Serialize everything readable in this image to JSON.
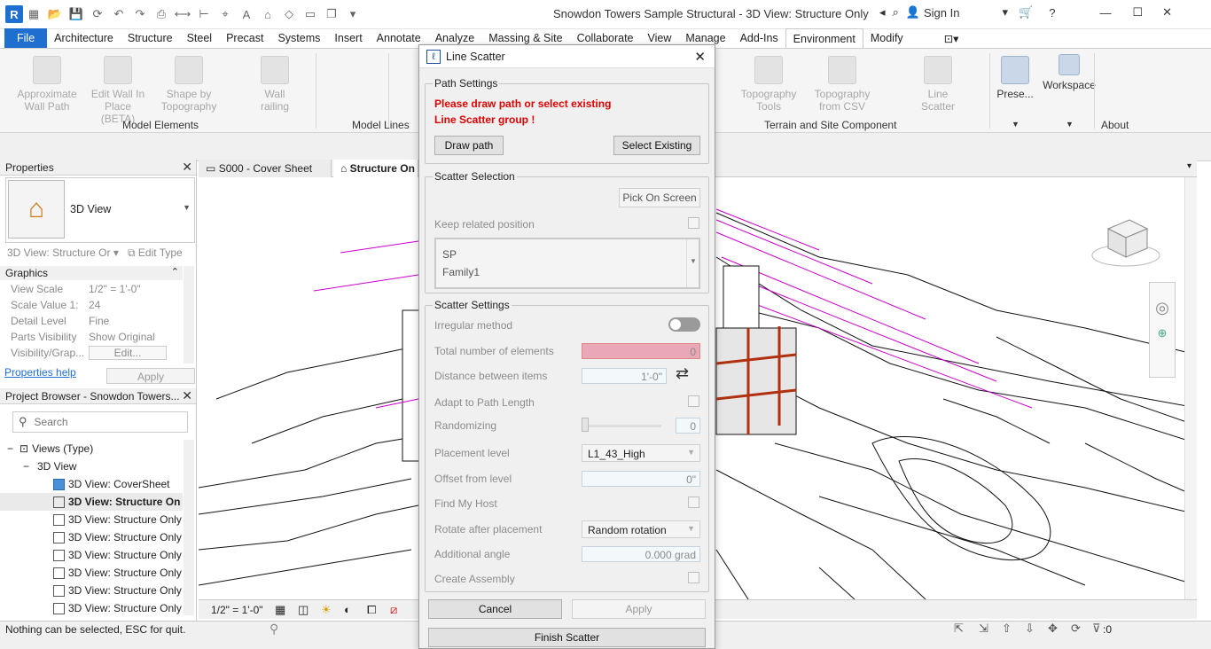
{
  "window": {
    "title": "Snowdon Towers Sample Structural - 3D View: Structure Only",
    "sign_in": "Sign In"
  },
  "menu": [
    "File",
    "Architecture",
    "Structure",
    "Steel",
    "Precast",
    "Systems",
    "Insert",
    "Annotate",
    "Analyze",
    "Massing & Site",
    "Collaborate",
    "View",
    "Manage",
    "Add-Ins",
    "Environment",
    "Modify"
  ],
  "ribbon": {
    "buttons": [
      "Approximate Wall Path",
      "Edit Wall In Place (BETA)",
      "Shape by Topography",
      "Wall railing",
      "Topography Tools",
      "Topography from CSV",
      "Line Scatter",
      "Prese...",
      "Workspace"
    ],
    "groups": [
      "Model Elements",
      "Model Lines",
      "Terrain and Site Component",
      "About"
    ]
  },
  "properties": {
    "title": "Properties",
    "type_name": "3D View",
    "instance": "3D View: Structure Or",
    "edit_type": "Edit Type",
    "section": "Graphics",
    "rows": [
      {
        "k": "View Scale",
        "v": "1/2\" = 1'-0\""
      },
      {
        "k": "Scale Value   1:",
        "v": "24"
      },
      {
        "k": "Detail Level",
        "v": "Fine"
      },
      {
        "k": "Parts Visibility",
        "v": "Show Original"
      },
      {
        "k": "Visibility/Grap...",
        "v": "Edit..."
      }
    ],
    "help_link": "Properties help",
    "apply": "Apply"
  },
  "browser": {
    "title": "Project Browser - Snowdon Towers...",
    "search_placeholder": "Search",
    "views_root": "Views (Type)",
    "group": "3D View",
    "items": [
      "3D View: CoverSheet",
      "3D View: Structure On",
      "3D View: Structure Only",
      "3D View: Structure Only",
      "3D View: Structure Only",
      "3D View: Structure Only",
      "3D View: Structure Only",
      "3D View: Structure Only"
    ]
  },
  "view_tabs": [
    "S000 - Cover Sheet",
    "Structure On"
  ],
  "view_bar": {
    "scale": "1/2\" = 1'-0\""
  },
  "status": {
    "message": "Nothing can be selected, ESC for quit.",
    "filter_count": ":0"
  },
  "dialog": {
    "title": "Line Scatter",
    "path_settings": {
      "legend": "Path Settings",
      "warning_line1": "Please draw path or select existing",
      "warning_line2": "Line Scatter group !",
      "draw_path": "Draw path",
      "select_existing": "Select Existing"
    },
    "scatter_selection": {
      "legend": "Scatter Selection",
      "pick_on_screen": "Pick On Screen",
      "keep_related": "Keep related position",
      "list": [
        "SP",
        "Family1"
      ]
    },
    "scatter_settings": {
      "legend": "Scatter Settings",
      "irregular": "Irregular method",
      "total_label": "Total number of elements",
      "total_value": "0",
      "distance_label": "Distance between items",
      "distance_value": "1'-0\"",
      "adapt": "Adapt to Path Length",
      "randomizing": "Randomizing",
      "randomizing_value": "0",
      "placement_label": "Placement level",
      "placement_value": "L1_43_High",
      "offset_label": "Offset from level",
      "offset_value": "0\"",
      "find_host": "Find My Host",
      "rotate_label": "Rotate after placement",
      "rotate_value": "Random rotation",
      "angle_label": "Additional angle",
      "angle_value": "0.000 grad",
      "create_assembly": "Create Assembly"
    },
    "cancel": "Cancel",
    "apply": "Apply",
    "finish": "Finish Scatter"
  },
  "colors": {
    "accent": "#1f6fd0",
    "warning": "#e00000",
    "total_field": "#e8a8b8",
    "magenta_lines": "#cc00cc"
  }
}
